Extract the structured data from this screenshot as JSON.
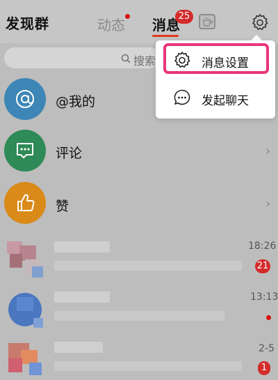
{
  "header": {
    "title": "发现群",
    "tabs": [
      {
        "label": "动态",
        "has_dot": true
      },
      {
        "label": "消息",
        "badge": "25",
        "active": true
      }
    ]
  },
  "search": {
    "placeholder": "搜索"
  },
  "rows": [
    {
      "label": "@我的",
      "icon": "at-icon",
      "color": "#3d86b6"
    },
    {
      "label": "评论",
      "icon": "comment-icon",
      "color": "#2e8a56"
    },
    {
      "label": "赞",
      "icon": "thumbs-up-icon",
      "color": "#d98a18"
    }
  ],
  "conversations": [
    {
      "time": "18:26",
      "badge": "21"
    },
    {
      "time": "13:13",
      "badge": ""
    },
    {
      "time": "2-5",
      "badge": "1"
    }
  ],
  "popup": {
    "items": [
      {
        "label": "消息设置",
        "icon": "gear-icon"
      },
      {
        "label": "发起聊天",
        "icon": "chat-bubble-icon"
      }
    ]
  },
  "colors": {
    "accent": "#e03a1e",
    "highlight": "#e8357a",
    "badge": "#d42b2b"
  }
}
